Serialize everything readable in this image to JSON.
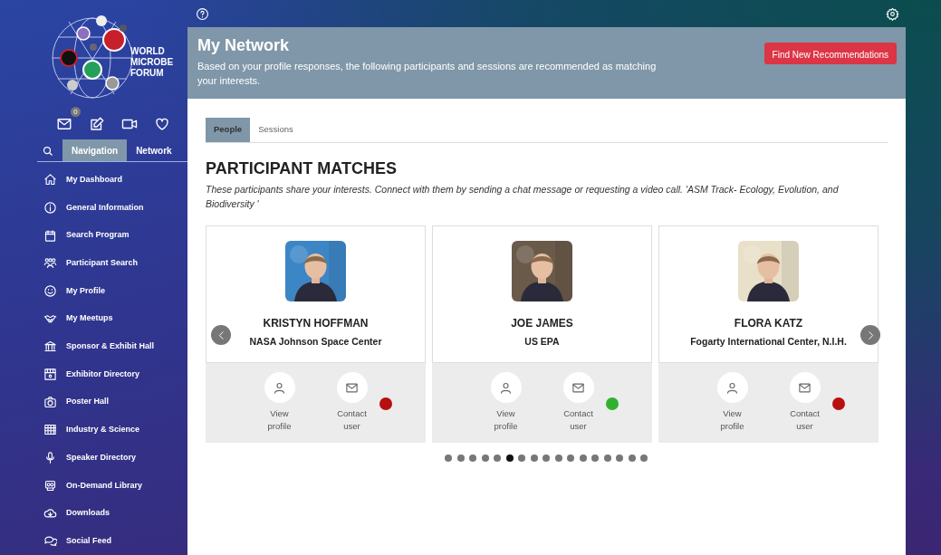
{
  "sidebar": {
    "logo_lines": [
      "WORLD",
      "MICROBE",
      "FORUM"
    ],
    "toolbar": [
      {
        "kind": "mail",
        "badge": "0"
      },
      {
        "kind": "edit"
      },
      {
        "kind": "video"
      },
      {
        "kind": "heart"
      }
    ],
    "tabs": [
      {
        "label": "Navigation",
        "selected": true
      },
      {
        "label": "Network",
        "selected": false
      }
    ],
    "items": [
      {
        "label": "My Dashboard"
      },
      {
        "label": "General Information"
      },
      {
        "label": "Search Program"
      },
      {
        "label": "Participant Search"
      },
      {
        "label": "My Profile"
      },
      {
        "label": "My Meetups"
      },
      {
        "label": "Sponsor & Exhibit Hall"
      },
      {
        "label": "Exhibitor Directory"
      },
      {
        "label": "Poster Hall"
      },
      {
        "label": "Industry & Science"
      },
      {
        "label": "Speaker Directory"
      },
      {
        "label": "On-Demand Library"
      },
      {
        "label": "Downloads"
      },
      {
        "label": "Social Feed"
      }
    ]
  },
  "header": {
    "title": "My Network",
    "description": "Based on your profile responses, the following participants and sessions are recommended as matching your interests.",
    "button": "Find New Recommendations"
  },
  "tabs": [
    {
      "label": "People",
      "selected": true
    },
    {
      "label": "Sessions",
      "selected": false
    }
  ],
  "section": {
    "title": "PARTICIPANT MATCHES",
    "description": "These participants share your interests. Connect with them by sending a chat message or requesting a video call. 'ASM Track- Ecology, Evolution, and Biodiversity '"
  },
  "participants": [
    {
      "name": "KRISTYN HOFFMAN",
      "organization": "NASA Johnson Space Center",
      "view_label": "View profile",
      "contact_label": "Contact user",
      "color": "#b80f0f"
    },
    {
      "name": "JOE JAMES",
      "organization": "US EPA",
      "view_label": "View profile",
      "contact_label": "Contact user",
      "color": "#2fb12f"
    },
    {
      "name": "FLORA KATZ",
      "organization": "Fogarty International Center, N.I.H.",
      "view_label": "View profile",
      "contact_label": "Contact user",
      "color": "#b80f0f"
    }
  ],
  "pager": [
    {
      "selected": false
    },
    {
      "selected": false
    },
    {
      "selected": false
    },
    {
      "selected": false
    },
    {
      "selected": false
    },
    {
      "selected": true
    },
    {
      "selected": false
    },
    {
      "selected": false
    },
    {
      "selected": false
    },
    {
      "selected": false
    },
    {
      "selected": false
    },
    {
      "selected": false
    },
    {
      "selected": false
    },
    {
      "selected": false
    },
    {
      "selected": false
    },
    {
      "selected": false
    },
    {
      "selected": false
    }
  ]
}
